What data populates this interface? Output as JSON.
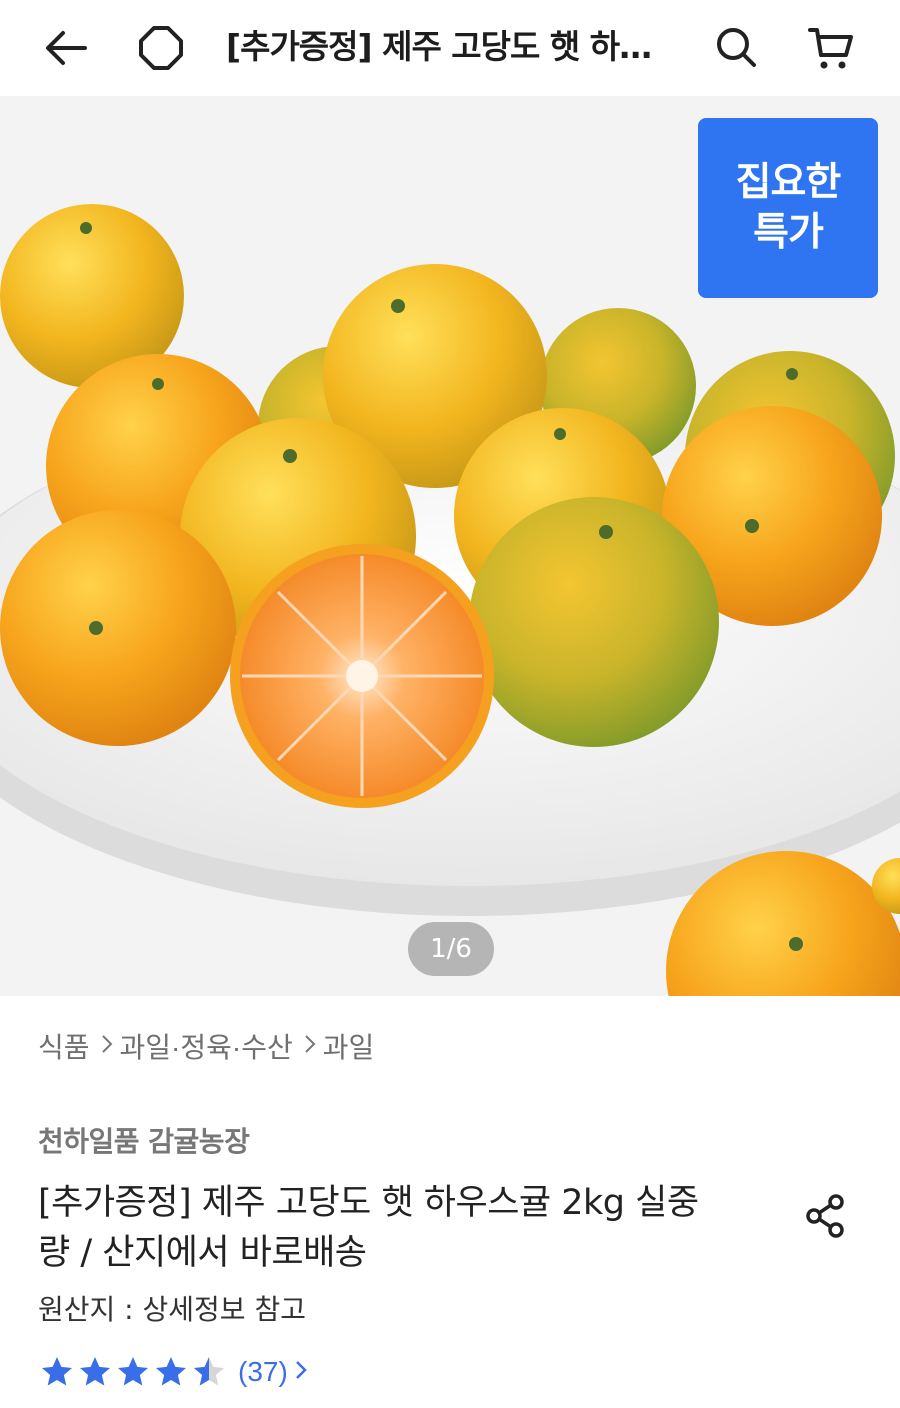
{
  "header": {
    "title": "[추가증정] 제주 고당도 햇 하우스귤 2kg 실중량 / 산지에서 바로배송",
    "icons": [
      "back-arrow-icon",
      "home-icon",
      "search-icon",
      "cart-icon"
    ]
  },
  "hero": {
    "badge_line1": "집요한",
    "badge_line2": "특가",
    "pager": "1/6",
    "colors": {
      "badge": "#2f74f0"
    }
  },
  "breadcrumb": {
    "items": [
      "식품",
      "과일·정육·수산",
      "과일"
    ]
  },
  "product": {
    "seller": "천하일품 감귤농장",
    "title": "[추가증정] 제주 고당도 햇 하우스귤 2kg 실중량 / 산지에서 바로배송",
    "origin": "원산지 : 상세정보 참고",
    "rating_value": 4.5,
    "review_count": "(37)",
    "colors": {
      "stars": "#3a6ee8"
    }
  }
}
